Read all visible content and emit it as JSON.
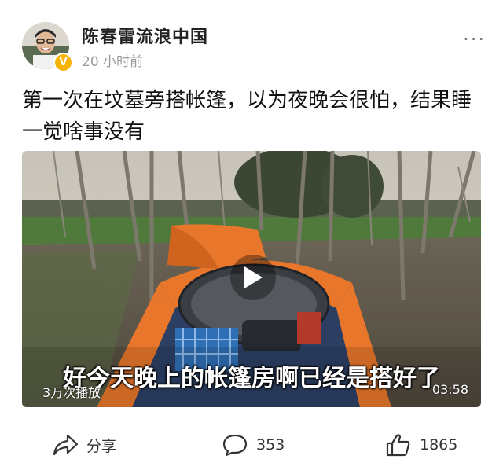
{
  "post": {
    "username": "陈春雷流浪中国",
    "timestamp": "20 小时前",
    "verified_mark": "V",
    "more_label": "···",
    "text": "第一次在坟墓旁搭帐篷，以为夜晚会很怕，结果睡一觉啥事没有"
  },
  "video": {
    "subtitle": "好今天晚上的帐篷房啊已经是搭好了",
    "views": "3万次播放",
    "duration": "03:58"
  },
  "actions": {
    "share_label": "分享",
    "comments_count": "353",
    "likes_count": "1865"
  },
  "icons": {
    "share": "share-icon",
    "comment": "comment-icon",
    "like": "thumbs-up-icon",
    "play": "play-icon",
    "more": "more-icon"
  },
  "colors": {
    "verified": "#f6b300",
    "tent_orange": "#e8772b",
    "tent_blue": "#2c3f63"
  }
}
